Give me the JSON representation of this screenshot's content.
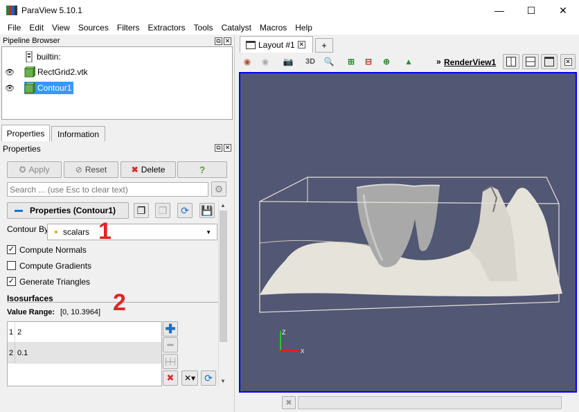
{
  "window": {
    "title": "ParaView 5.10.1",
    "minimize": "—",
    "maximize": "☐",
    "close": "✕"
  },
  "menu": [
    "File",
    "Edit",
    "View",
    "Sources",
    "Filters",
    "Extractors",
    "Tools",
    "Catalyst",
    "Macros",
    "Help"
  ],
  "pipeline": {
    "title": "Pipeline Browser",
    "items": [
      "builtin:",
      "RectGrid2.vtk",
      "Contour1"
    ]
  },
  "tabs": {
    "properties": "Properties",
    "information": "Information"
  },
  "properties": {
    "title": "Properties",
    "apply": "Apply",
    "reset": "Reset",
    "delete": "Delete",
    "help": "?",
    "search_placeholder": "Search ... (use Esc to clear text)",
    "section_label": "Properties (Contour1)",
    "contour_by_label": "Contour By",
    "contour_by_value": "scalars",
    "compute_normals": {
      "label": "Compute Normals",
      "checked": true
    },
    "compute_gradients": {
      "label": "Compute Gradients",
      "checked": false
    },
    "generate_triangles": {
      "label": "Generate Triangles",
      "checked": true
    },
    "isosurfaces_header": "Isosurfaces",
    "value_range_label": "Value Range:",
    "value_range": "[0, 10.3964]",
    "iso_rows": [
      {
        "index": "1",
        "value": "2"
      },
      {
        "index": "2",
        "value": "0.1"
      }
    ]
  },
  "annotations": {
    "one": "1",
    "two": "2"
  },
  "layout": {
    "tab_label": "Layout #1",
    "add_tab": "+",
    "view_label": "RenderView1",
    "toggle_3d": "3D"
  },
  "axes": {
    "z": "Z",
    "x": "X"
  },
  "colors": {
    "viewport_bg": "#525774",
    "surface": "#e6e4da",
    "selection": "#3399ff",
    "annotation": "#e52222",
    "view_border": "#0000ff"
  }
}
